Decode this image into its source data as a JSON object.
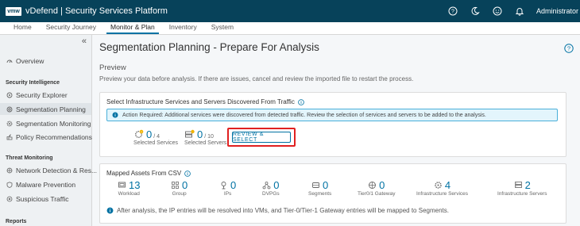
{
  "header": {
    "logo": "vmw",
    "title": "vDefend | Security Services Platform",
    "user": "Administrator"
  },
  "nav": {
    "tabs": [
      "Home",
      "Security Journey",
      "Monitor & Plan",
      "Inventory",
      "System"
    ]
  },
  "sidebar": {
    "collapse": "«",
    "overview": "Overview",
    "security_intelligence": {
      "heading": "Security Intelligence",
      "items": [
        "Security Explorer",
        "Segmentation Planning",
        "Segmentation Monitoring",
        "Policy Recommendations"
      ]
    },
    "threat_monitoring": {
      "heading": "Threat Monitoring",
      "items": [
        "Network Detection & Res...",
        "Malware Prevention",
        "Suspicious Traffic"
      ]
    },
    "reports": {
      "heading": "Reports"
    }
  },
  "main": {
    "title": "Segmentation Planning - Prepare For Analysis",
    "section_title": "Preview",
    "section_desc": "Preview your data before analysis. If there are issues, cancel and review the imported file to restart the process.",
    "infra_card": {
      "title": "Select Infrastructure Services and Servers Discovered From Traffic",
      "alert": "Action Required: Additional services were discovered from detected traffic. Review the selection of services and servers to be added to the analysis.",
      "services": {
        "value": "0",
        "total": "/ 4",
        "label": "Selected Services"
      },
      "servers": {
        "value": "0",
        "total": "/ 10",
        "label": "Selected Servers"
      },
      "button": "REVIEW & SELECT"
    },
    "assets_card": {
      "title": "Mapped Assets From CSV",
      "assets": [
        {
          "value": "13",
          "label": "Workload",
          "icon": "workload-icon"
        },
        {
          "value": "0",
          "label": "Group",
          "icon": "group-icon"
        },
        {
          "value": "0",
          "label": "IPs",
          "icon": "ip-icon"
        },
        {
          "value": "0",
          "label": "DVPGs",
          "icon": "dvpg-icon"
        },
        {
          "value": "0",
          "label": "Segments",
          "icon": "segment-icon"
        },
        {
          "value": "0",
          "label": "Tier0/1 Gateway",
          "icon": "gateway-icon"
        },
        {
          "value": "4",
          "label": "Infrastructure Services",
          "icon": "infra-services-icon"
        },
        {
          "value": "2",
          "label": "Infrastructure Servers",
          "icon": "infra-servers-icon"
        }
      ],
      "note": "After analysis, the IP entries will be resolved into VMs, and Tier-0/Tier-1 Gateway entries will be mapped to Segments."
    }
  },
  "colors": {
    "header_bg": "#07425a",
    "accent": "#0072a3",
    "highlight": "#e02020",
    "alert_bg": "#e3f5fc"
  }
}
